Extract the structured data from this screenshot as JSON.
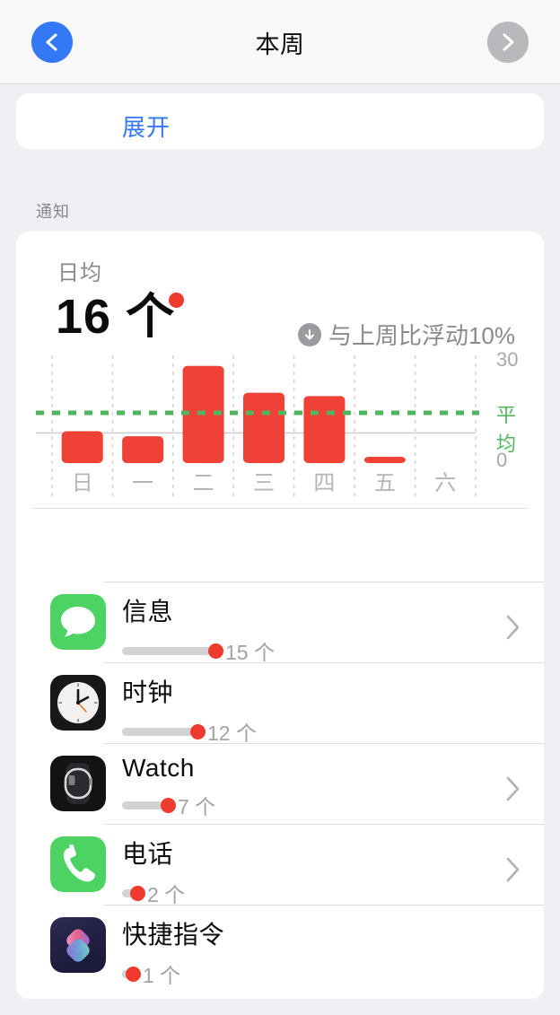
{
  "navbar": {
    "title": "本周",
    "prev_icon": "chevron-left-icon",
    "next_icon": "chevron-right-icon",
    "prev_color": "#3478f6",
    "next_color": "#b9b9bd"
  },
  "expand_card": {
    "label": "展开"
  },
  "section": {
    "label": "通知"
  },
  "summary": {
    "average_label": "日均",
    "average_value": "16 个",
    "dot_color": "#ef3b2d",
    "comparison_icon": "arrow-down-circle-icon",
    "comparison_text": "与上周比浮动10%"
  },
  "chart_data": {
    "type": "bar",
    "title": "通知",
    "categories": [
      "日",
      "一",
      "二",
      "三",
      "四",
      "五",
      "六"
    ],
    "values": [
      9.5,
      8,
      29,
      21,
      20,
      1.5,
      0
    ],
    "ylim": [
      0,
      30
    ],
    "ytick_labels": [
      "30",
      "0"
    ],
    "average_value": 15,
    "average_label": "平均",
    "average_line_color": "#52b45e",
    "bar_color": "#ef4136",
    "baseline_value": 9,
    "grid": true,
    "xlabel": "",
    "ylabel": ""
  },
  "apps": [
    {
      "name": "信息",
      "icon": "messages-icon",
      "count_text": "15 个",
      "meter_width": 100,
      "chevron": true
    },
    {
      "name": "时钟",
      "icon": "clock-icon",
      "count_text": "12 个",
      "meter_width": 80,
      "chevron": false
    },
    {
      "name": "Watch",
      "icon": "watch-icon",
      "count_text": "7 个",
      "meter_width": 47,
      "chevron": true
    },
    {
      "name": "电话",
      "icon": "phone-icon",
      "count_text": "2 个",
      "meter_width": 13,
      "chevron": true
    },
    {
      "name": "快捷指令",
      "icon": "shortcuts-icon",
      "count_text": "1 个",
      "meter_width": 8,
      "chevron": false
    }
  ]
}
